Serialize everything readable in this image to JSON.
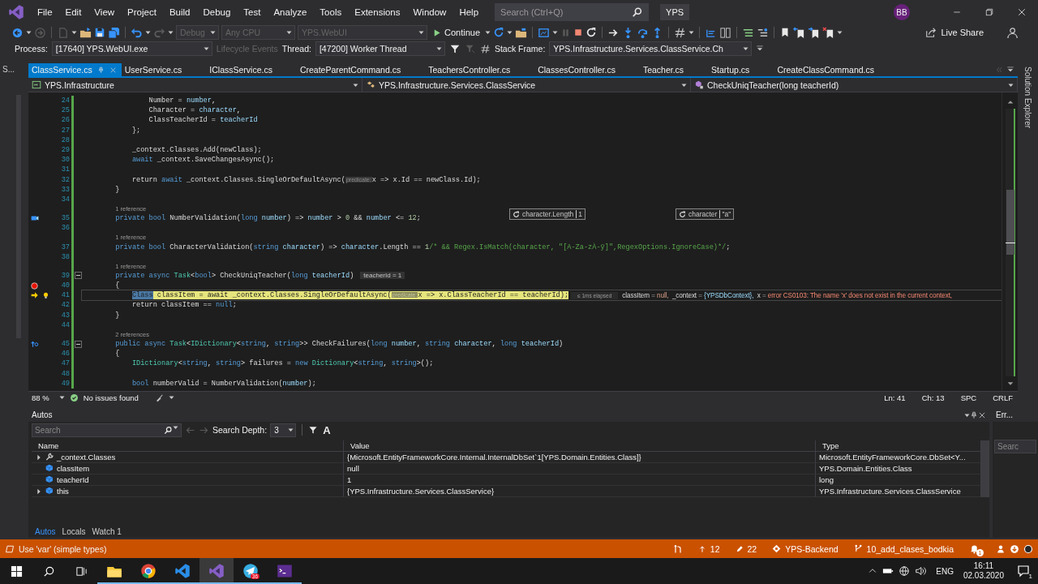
{
  "menu": {
    "items": [
      "File",
      "Edit",
      "View",
      "Project",
      "Build",
      "Debug",
      "Test",
      "Analyze",
      "Tools",
      "Extensions",
      "Window",
      "Help"
    ],
    "search": {
      "placeholder": "Search (Ctrl+Q)"
    },
    "solution": "YPS",
    "account": "BB"
  },
  "toolbar": {
    "configuration": {
      "value": "Debug",
      "disabled": true
    },
    "platform": {
      "value": "Any CPU",
      "disabled": true
    },
    "startup_project": {
      "value": "YPS.WebUI",
      "disabled": true
    },
    "continue": "Continue",
    "live_share": "Live Share"
  },
  "debug_location": {
    "process_label": "Process:",
    "process": "[17640] YPS.WebUI.exe",
    "lifecycle": {
      "label": "Lifecycle Events",
      "disabled": true
    },
    "thread_label": "Thread:",
    "thread": "[47200] Worker Thread",
    "stack_frame_label": "Stack Frame:",
    "stack_frame": "YPS.Infrastructure.Services.ClassService.Ch"
  },
  "left_strip": {
    "tab": "S..."
  },
  "tabs": [
    {
      "label": "ClassService.cs",
      "selected": true
    },
    {
      "label": "UserService.cs",
      "selected": false
    },
    {
      "label": "IClassService.cs",
      "selected": false
    },
    {
      "label": "CreateParentCommand.cs",
      "selected": false
    },
    {
      "label": "TeachersController.cs",
      "selected": false
    },
    {
      "label": "ClassesController.cs",
      "selected": false
    },
    {
      "label": "Teacher.cs",
      "selected": false
    },
    {
      "label": "Startup.cs",
      "selected": false
    },
    {
      "label": "CreateClassCommand.cs",
      "selected": false
    }
  ],
  "nav_bar": {
    "project": "YPS.Infrastructure",
    "type": "YPS.Infrastructure.Services.ClassService",
    "member": "CheckUniqTeacher(long teacherId)"
  },
  "code": {
    "lines": [
      {
        "kind": "code",
        "number": "24",
        "tokens": [
          {
            "t": "                Number = ",
            "kind": "plain"
          },
          {
            "t": "number",
            "kind": "param"
          },
          {
            "t": ",",
            "kind": "plain"
          }
        ],
        "current": false,
        "breakpoint": false
      },
      {
        "kind": "code",
        "number": "25",
        "tokens": [
          {
            "t": "                Character = ",
            "kind": "plain"
          },
          {
            "t": "character",
            "kind": "param"
          },
          {
            "t": ",",
            "kind": "plain"
          }
        ],
        "current": false,
        "breakpoint": false
      },
      {
        "kind": "code",
        "number": "26",
        "tokens": [
          {
            "t": "                ClassTeacherId = ",
            "kind": "plain"
          },
          {
            "t": "teacherId",
            "kind": "param"
          }
        ],
        "current": false,
        "breakpoint": false
      },
      {
        "kind": "code",
        "number": "27",
        "tokens": [
          {
            "t": "            };",
            "kind": "plain"
          }
        ],
        "current": false,
        "breakpoint": false
      },
      {
        "kind": "code",
        "number": "28",
        "current": false,
        "breakpoint": false
      },
      {
        "kind": "code",
        "number": "29",
        "tokens": [
          {
            "t": "            _context.Classes.Add(newClass);",
            "kind": "plain"
          }
        ],
        "current": false,
        "breakpoint": false
      },
      {
        "kind": "code",
        "number": "30",
        "tokens": [
          {
            "t": "            await",
            "kind": "kw"
          },
          {
            "t": " _context.SaveChangesAsync();",
            "kind": "plain"
          }
        ],
        "current": false,
        "breakpoint": false
      },
      {
        "kind": "code",
        "number": "31",
        "current": false,
        "breakpoint": false
      },
      {
        "kind": "code",
        "number": "32",
        "tokens": [
          {
            "t": "            return ",
            "kind": "plain"
          },
          {
            "t": "await",
            "kind": "kw"
          },
          {
            "t": " _context.Classes.SingleOrDefaultAsync(",
            "kind": "plain"
          },
          {
            "t": "predicate:",
            "kind": "hint"
          },
          {
            "t": "x => x.Id == newClass.Id);",
            "kind": "plain"
          }
        ],
        "current": false,
        "breakpoint": false
      },
      {
        "kind": "code",
        "number": "33",
        "tokens": [
          {
            "t": "        }",
            "kind": "plain"
          }
        ],
        "current": false,
        "breakpoint": false
      },
      {
        "kind": "code",
        "number": "34",
        "current": false,
        "breakpoint": false
      },
      {
        "kind": "lens",
        "text": "1 reference"
      },
      {
        "kind": "code",
        "number": "35",
        "tokens": [
          {
            "t": "        private ",
            "kind": "kw"
          },
          {
            "t": "bool",
            "kind": "kw"
          },
          {
            "t": " NumberValidation(",
            "kind": "plain"
          },
          {
            "t": "long ",
            "kind": "kw"
          },
          {
            "t": "number",
            "kind": "param"
          },
          {
            "t": ") => ",
            "kind": "plain"
          },
          {
            "t": "number",
            "kind": "param"
          },
          {
            "t": " > ",
            "kind": "plain"
          },
          {
            "t": "0",
            "kind": "num"
          },
          {
            "t": " && ",
            "kind": "plain"
          },
          {
            "t": "number",
            "kind": "param"
          },
          {
            "t": " <= ",
            "kind": "plain"
          },
          {
            "t": "12",
            "kind": "num"
          },
          {
            "t": ";",
            "kind": "plain"
          }
        ],
        "current": false,
        "breakpoint": false,
        "markers": [
          {
            "kind": "datatip"
          }
        ]
      },
      {
        "kind": "code",
        "number": "36",
        "current": false,
        "breakpoint": false
      },
      {
        "kind": "lens",
        "text": "1 reference"
      },
      {
        "kind": "code",
        "number": "37",
        "tokens": [
          {
            "t": "        private ",
            "kind": "kw"
          },
          {
            "t": "bool",
            "kind": "kw"
          },
          {
            "t": " CharacterValidation(",
            "kind": "plain"
          },
          {
            "t": "string ",
            "kind": "kw"
          },
          {
            "t": "character",
            "kind": "param"
          },
          {
            "t": ") => ",
            "kind": "plain"
          },
          {
            "t": "character",
            "kind": "param"
          },
          {
            "t": ".Length == ",
            "kind": "plain"
          },
          {
            "t": "1",
            "kind": "num"
          },
          {
            "t": "/* && Regex.IsMatch(character, \"[A-Za-zÀ-ÿ]\",RegexOptions.IgnoreCase)*/",
            "kind": "comment"
          },
          {
            "t": ";",
            "kind": "plain"
          }
        ],
        "current": false,
        "breakpoint": false
      },
      {
        "kind": "code",
        "number": "38",
        "current": false,
        "breakpoint": false
      },
      {
        "kind": "lens",
        "text": "1 reference"
      },
      {
        "kind": "code",
        "number": "39",
        "tokens": [
          {
            "t": "        private ",
            "kind": "kw"
          },
          {
            "t": "async ",
            "kind": "kw"
          },
          {
            "t": "Task",
            "kind": "type"
          },
          {
            "t": "<",
            "kind": "plain"
          },
          {
            "t": "bool",
            "kind": "kw"
          },
          {
            "t": "> CheckUniqTeacher(",
            "kind": "plain"
          },
          {
            "t": "long ",
            "kind": "kw"
          },
          {
            "t": "teacherId",
            "kind": "param"
          },
          {
            "t": ")",
            "kind": "plain"
          }
        ],
        "inline_value": "teacherId = 1",
        "current": false,
        "breakpoint": false,
        "markers": [
          {
            "kind": "fold"
          }
        ]
      },
      {
        "kind": "code",
        "number": "40",
        "tokens": [
          {
            "t": "        {",
            "kind": "plain"
          }
        ],
        "current": false,
        "breakpoint": true
      },
      {
        "kind": "code",
        "number": "41",
        "tokens": [
          {
            "t": "            Class",
            "kind": "sel"
          },
          {
            "t": " classItem = await _context.Classes.SingleOrDefaultAsync(",
            "kind": "plain"
          },
          {
            "t": "predicate:",
            "kind": "hint"
          },
          {
            "t": "x => x.ClassTeacherId == teacherId);",
            "kind": "plain"
          }
        ],
        "current": true,
        "breakpoint": false,
        "markers": [
          {
            "kind": "lightbulb"
          }
        ],
        "elapsed": "≤ 1ms elapsed",
        "locals": [
          {
            "t": "classItem",
            "kind": "name"
          },
          {
            "t": " = ",
            "kind": "op"
          },
          {
            "t": "null,",
            "kind": "value"
          },
          {
            "t": "  _context",
            "kind": "name"
          },
          {
            "t": " = ",
            "kind": "op"
          },
          {
            "t": "{YPSDbContext},",
            "kind": "object"
          },
          {
            "t": "  x",
            "kind": "name"
          },
          {
            "t": " = ",
            "kind": "op"
          },
          {
            "t": "error CS0103: The name 'x' does not exist in the current context,",
            "kind": "error"
          }
        ]
      },
      {
        "kind": "code",
        "number": "42",
        "tokens": [
          {
            "t": "            return classItem == ",
            "kind": "plain"
          },
          {
            "t": "null",
            "kind": "kw"
          },
          {
            "t": ";",
            "kind": "plain"
          }
        ],
        "current": false,
        "breakpoint": false
      },
      {
        "kind": "code",
        "number": "43",
        "tokens": [
          {
            "t": "        }",
            "kind": "plain"
          }
        ],
        "current": false,
        "breakpoint": false
      },
      {
        "kind": "code",
        "number": "44",
        "current": false,
        "breakpoint": false
      },
      {
        "kind": "lens",
        "text": "2 references"
      },
      {
        "kind": "code",
        "number": "45",
        "tokens": [
          {
            "t": "        public ",
            "kind": "kw"
          },
          {
            "t": "async ",
            "kind": "kw"
          },
          {
            "t": "Task",
            "kind": "type"
          },
          {
            "t": "<",
            "kind": "plain"
          },
          {
            "t": "IDictionary",
            "kind": "type"
          },
          {
            "t": "<",
            "kind": "plain"
          },
          {
            "t": "string",
            "kind": "kw"
          },
          {
            "t": ", ",
            "kind": "plain"
          },
          {
            "t": "string",
            "kind": "kw"
          },
          {
            "t": ">> CheckFailures(",
            "kind": "plain"
          },
          {
            "t": "long ",
            "kind": "kw"
          },
          {
            "t": "number",
            "kind": "param"
          },
          {
            "t": ", ",
            "kind": "plain"
          },
          {
            "t": "string ",
            "kind": "kw"
          },
          {
            "t": "character",
            "kind": "param"
          },
          {
            "t": ", ",
            "kind": "plain"
          },
          {
            "t": "long ",
            "kind": "kw"
          },
          {
            "t": "teacherId",
            "kind": "param"
          },
          {
            "t": ")",
            "kind": "plain"
          }
        ],
        "current": false,
        "breakpoint": false,
        "markers": [
          {
            "kind": "fold"
          },
          {
            "kind": "step"
          }
        ]
      },
      {
        "kind": "code",
        "number": "46",
        "tokens": [
          {
            "t": "        {",
            "kind": "plain"
          }
        ],
        "current": false,
        "breakpoint": false
      },
      {
        "kind": "code",
        "number": "47",
        "tokens": [
          {
            "t": "            IDictionary",
            "kind": "type"
          },
          {
            "t": "<",
            "kind": "plain"
          },
          {
            "t": "string",
            "kind": "kw"
          },
          {
            "t": ", ",
            "kind": "plain"
          },
          {
            "t": "string",
            "kind": "kw"
          },
          {
            "t": "> failures = ",
            "kind": "plain"
          },
          {
            "t": "new ",
            "kind": "kw"
          },
          {
            "t": "Dictionary",
            "kind": "type"
          },
          {
            "t": "<",
            "kind": "plain"
          },
          {
            "t": "string",
            "kind": "kw"
          },
          {
            "t": ", ",
            "kind": "plain"
          },
          {
            "t": "string",
            "kind": "kw"
          },
          {
            "t": ">();",
            "kind": "plain"
          }
        ],
        "current": false,
        "breakpoint": false
      },
      {
        "kind": "code",
        "number": "48",
        "current": false,
        "breakpoint": false
      },
      {
        "kind": "code",
        "number": "49",
        "tokens": [
          {
            "t": "            bool",
            "kind": "kw"
          },
          {
            "t": " numberValid = NumberValidation(",
            "kind": "plain"
          },
          {
            "t": "number",
            "kind": "param"
          },
          {
            "t": ");",
            "kind": "plain"
          }
        ],
        "current": false,
        "breakpoint": false
      }
    ],
    "pinned_tips": [
      {
        "expression": "character.Length",
        "value": "1"
      },
      {
        "expression": "character",
        "value": "\"a\""
      }
    ]
  },
  "editor_status": {
    "zoom": "88 %",
    "issues": "No issues found",
    "line": "Ln: 41",
    "column": "Ch: 13",
    "whitespace": "SPC",
    "line_endings": "CRLF"
  },
  "right_strip": {
    "tab": "Solution Explorer"
  },
  "autos": {
    "title": "Autos",
    "search": {
      "placeholder": "Search"
    },
    "depth_label": "Search Depth:",
    "depth": "3",
    "text_toggle": "A",
    "columns": [
      "Name",
      "Value",
      "Type"
    ],
    "rows": [
      {
        "kind": "property",
        "name": "_context.Classes",
        "value": "{Microsoft.EntityFrameworkCore.Internal.InternalDbSet`1[YPS.Domain.Entities.Class]}",
        "type": "Microsoft.EntityFrameworkCore.DbSet<Y...",
        "expandable": true
      },
      {
        "kind": "local",
        "name": "classItem",
        "value": "null",
        "type": "YPS.Domain.Entities.Class",
        "expandable": false
      },
      {
        "kind": "local",
        "name": "teacherId",
        "value": "1",
        "type": "long",
        "expandable": false
      },
      {
        "kind": "local",
        "name": "this",
        "value": "{YPS.Infrastructure.Services.ClassService}",
        "type": "YPS.Infrastructure.Services.ClassService",
        "expandable": true
      }
    ],
    "tabs": [
      {
        "label": "Autos",
        "selected": true
      },
      {
        "label": "Locals",
        "selected": false
      },
      {
        "label": "Watch 1",
        "selected": false
      }
    ]
  },
  "errors_panel": {
    "title": "Err...",
    "search": {
      "placeholder": "Searc"
    }
  },
  "status_bar": {
    "message": "Use 'var' (simple types)",
    "commits_up": "12",
    "changes": "22",
    "repository": "YPS-Backend",
    "branch": "10_add_clases_bodkia",
    "notifications": "1"
  },
  "taskbar": {
    "apps": [
      {
        "kind": "folder",
        "selected": false
      },
      {
        "kind": "round",
        "selected": false
      },
      {
        "kind": "ribbon",
        "selected": false
      },
      {
        "kind": "infinity",
        "selected": true
      },
      {
        "kind": "plane",
        "selected": false,
        "badge": "36"
      },
      {
        "kind": "terminal",
        "selected": false
      }
    ],
    "language": "ENG",
    "time": "16:11",
    "date": "02.03.2020",
    "notifications": "1"
  }
}
